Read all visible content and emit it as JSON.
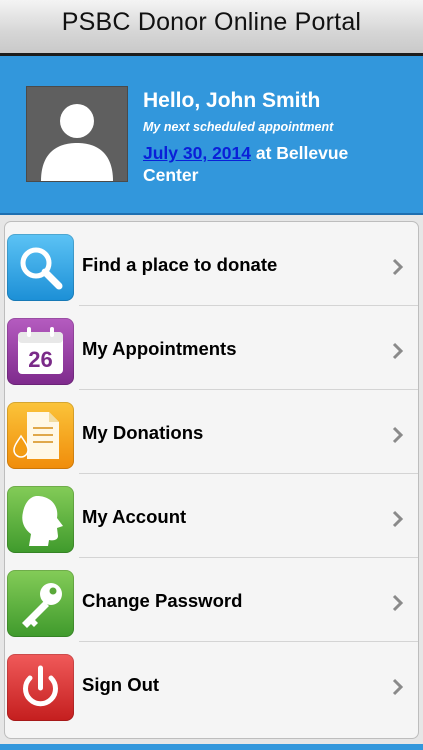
{
  "header": {
    "title": "PSBC Donor Online Portal"
  },
  "profile": {
    "greeting": "Hello, John Smith",
    "subtitle": "My next scheduled appointment",
    "appointment_date": "July 30, 2014",
    "appointment_location": " at Bellevue Center"
  },
  "menu": {
    "items": [
      {
        "label": "Find a place to donate",
        "icon": "search-icon",
        "color": "#2a9ee0"
      },
      {
        "label": "My Appointments",
        "icon": "calendar-icon",
        "color": "#9b3fa6",
        "icon_text": "26"
      },
      {
        "label": "My Donations",
        "icon": "document-drop-icon",
        "color": "#f39c12"
      },
      {
        "label": "My Account",
        "icon": "head-profile-icon",
        "color": "#5aa83a"
      },
      {
        "label": "Change Password",
        "icon": "key-icon",
        "color": "#5aa83a"
      },
      {
        "label": "Sign Out",
        "icon": "power-icon",
        "color": "#d92d2d"
      }
    ]
  }
}
